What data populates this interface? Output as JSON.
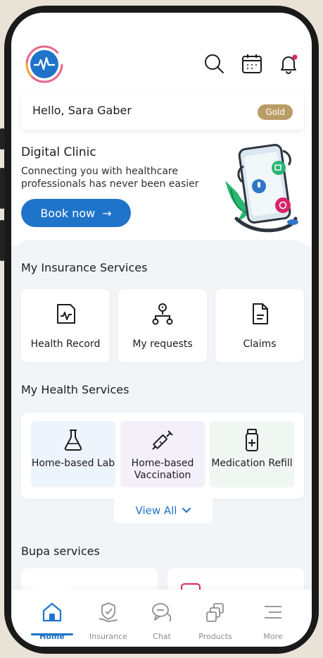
{
  "header": {
    "logo_icon": "heartbeat-logo-icon",
    "search_icon": "search-icon",
    "calendar_icon": "calendar-icon",
    "notification_icon": "bell-icon"
  },
  "greeting": {
    "text": "Hello, Sara Gaber",
    "badge": "Gold"
  },
  "digital_clinic": {
    "title": "Digital Clinic",
    "description": "Connecting you with healthcare professionals has never been easier",
    "button_label": "Book now",
    "button_arrow": "→"
  },
  "insurance_services": {
    "title": "My Insurance Services",
    "items": [
      {
        "label": "Health Record",
        "icon": "health-record-icon"
      },
      {
        "label": "My requests",
        "icon": "requests-icon"
      },
      {
        "label": "Claims",
        "icon": "claims-icon"
      }
    ]
  },
  "health_services": {
    "title": "My Health Services",
    "items": [
      {
        "label": "Home-based Lab",
        "icon": "lab-flask-icon"
      },
      {
        "label": "Home-based Vaccination",
        "icon": "syringe-icon"
      },
      {
        "label": "Medication Refill",
        "icon": "medicine-bottle-icon"
      }
    ],
    "view_all": "View All"
  },
  "bupa_services": {
    "title": "Bupa services"
  },
  "tabbar": {
    "tabs": [
      {
        "label": "Home",
        "icon": "home-icon",
        "active": true
      },
      {
        "label": "Insurance",
        "icon": "insurance-shield-icon"
      },
      {
        "label": "Chat",
        "icon": "chat-icon"
      },
      {
        "label": "Products",
        "icon": "products-icon"
      },
      {
        "label": "More",
        "icon": "menu-icon"
      }
    ]
  },
  "colors": {
    "primary": "#1f74c9",
    "gold": "#b89d67",
    "background": "#f3f4f7"
  }
}
